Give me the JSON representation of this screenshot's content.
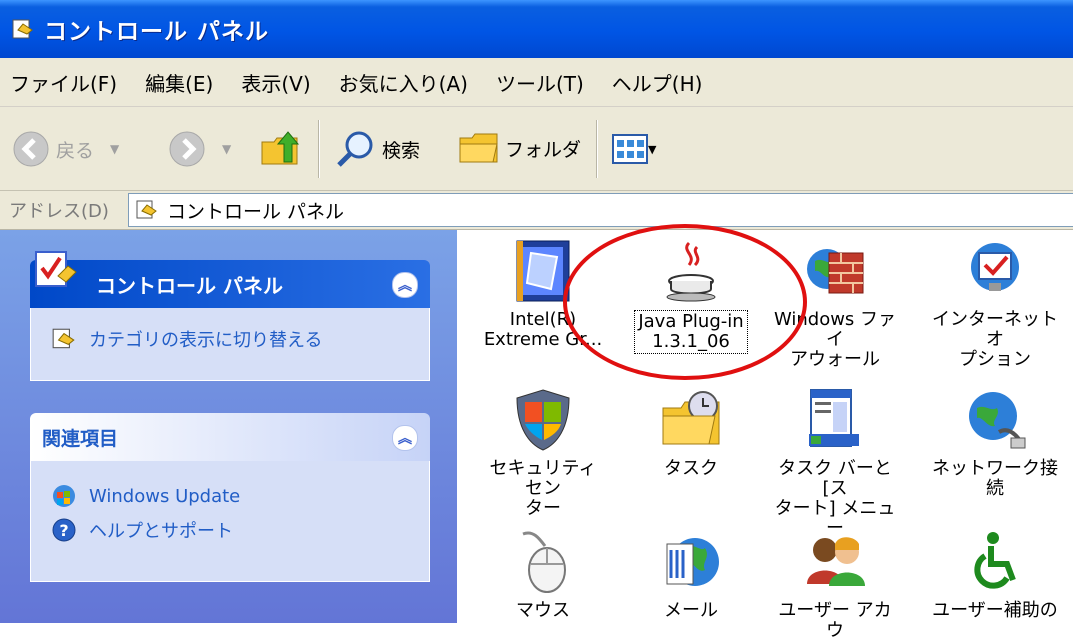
{
  "window": {
    "title": "コントロール パネル"
  },
  "menu": [
    "ファイル(F)",
    "編集(E)",
    "表示(V)",
    "お気に入り(A)",
    "ツール(T)",
    "ヘルプ(H)"
  ],
  "toolbar": {
    "back_label": "戻る",
    "search_label": "検索",
    "folders_label": "フォルダ"
  },
  "address": {
    "label": "アドレス(D)",
    "value": "コントロール パネル"
  },
  "left": {
    "cp_panel": {
      "title": "コントロール パネル",
      "link": "カテゴリの表示に切り替える"
    },
    "related_panel": {
      "title": "関連項目",
      "links": [
        "Windows Update",
        "ヘルプとサポート"
      ]
    }
  },
  "icons": [
    {
      "name": "intel",
      "label": "Intel(R)\nExtreme Gr..."
    },
    {
      "name": "java",
      "label": "Java Plug-in\n1.3.1_06"
    },
    {
      "name": "firewall",
      "label": "Windows ファイ\nアウォール"
    },
    {
      "name": "internet",
      "label": "インターネット オ\nプション"
    },
    {
      "name": "security",
      "label": "セキュリティ セン\nター"
    },
    {
      "name": "task",
      "label": "タスク"
    },
    {
      "name": "taskbar",
      "label": "タスク バーと [ス\nタート] メニュー"
    },
    {
      "name": "network",
      "label": "ネットワーク接\n続"
    },
    {
      "name": "mouse",
      "label": "マウス"
    },
    {
      "name": "mail",
      "label": "メール"
    },
    {
      "name": "user",
      "label": "ユーザー アカウ"
    },
    {
      "name": "access",
      "label": "ユーザー補助の"
    }
  ],
  "colors": {
    "titlebar": "#0055e5",
    "highlight_circle": "#e01010",
    "link": "#215dc6"
  }
}
